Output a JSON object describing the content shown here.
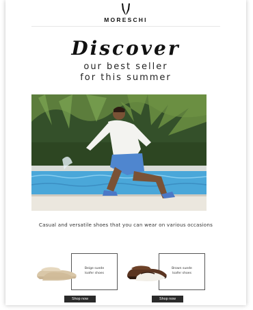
{
  "header": {
    "brand": "MORESCHI",
    "logo_icon": "moreschi-bull-horns-icon"
  },
  "hero": {
    "headline": "Discover",
    "subline_1": "our best seller",
    "subline_2": "for this summer"
  },
  "description": "Casual and versatile shoes that you can wear on various occasions",
  "products": [
    {
      "line_1": "Beige suede",
      "line_2": "loafer shoes",
      "button": "Shop now",
      "color": "#d9c7a8"
    },
    {
      "line_1": "Brown suede",
      "line_2": "loafer shoes",
      "button": "Shop now",
      "color": "#5a3420"
    }
  ]
}
